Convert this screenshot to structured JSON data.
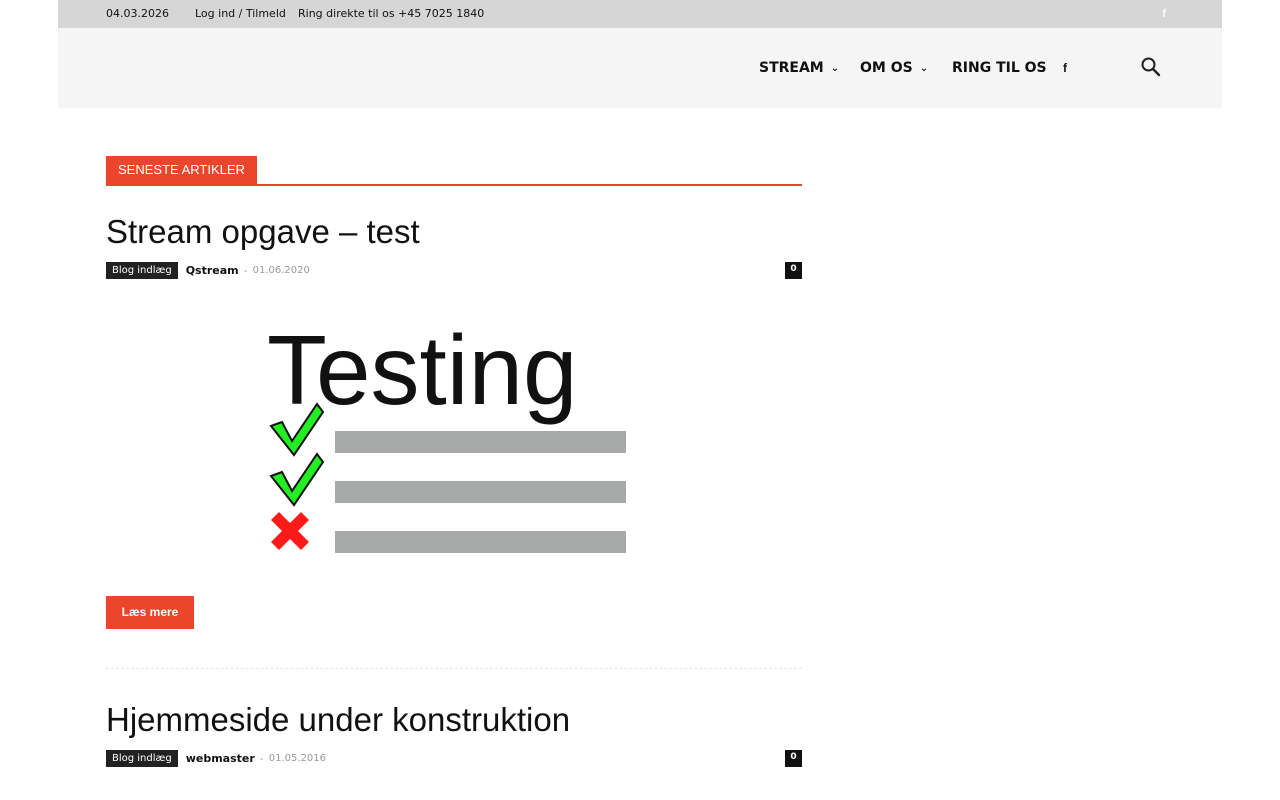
{
  "topbar": {
    "date": "04.03.2026",
    "login": "Log ind / Tilmeld",
    "phone": "Ring direkte til os +45 7025 1840",
    "facebook_glyph": "f",
    "facebook_icon": "facebook-icon"
  },
  "nav": {
    "items": [
      {
        "label": "STREAM",
        "has_dropdown": true
      },
      {
        "label": "OM OS",
        "has_dropdown": true
      },
      {
        "label": "RING TIL OS",
        "has_dropdown": false
      }
    ],
    "facebook_glyph": "f",
    "search_icon": "search-icon"
  },
  "block": {
    "title": "SENESTE ARTIKLER",
    "accent_color": "#e9462c"
  },
  "articles": [
    {
      "title": "Stream opgave – test",
      "category": "Blog indlæg",
      "author": "Qstream",
      "separator": "-",
      "date": "01.06.2020",
      "comments": "0",
      "image_text": "Testing",
      "read_more": "Læs mere"
    },
    {
      "title": "Hjemmeside under konstruktion",
      "category": "Blog indlæg",
      "author": "webmaster",
      "separator": "-",
      "date": "01.05.2016",
      "comments": "0"
    }
  ]
}
